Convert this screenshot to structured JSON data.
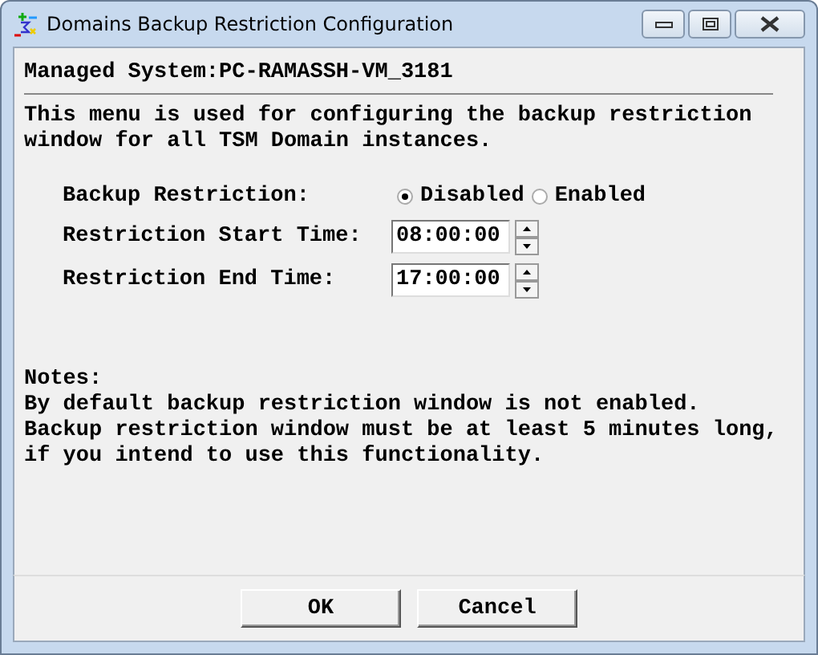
{
  "window": {
    "title": "Domains Backup Restriction Configuration"
  },
  "managed_system": "Managed System:PC-RAMASSH-VM_3181",
  "description": "This menu is used for configuring the backup restriction window for all TSM Domain instances.",
  "backup_restriction": {
    "label": "Backup Restriction:",
    "options": [
      {
        "label": "Disabled",
        "selected": true
      },
      {
        "label": "Enabled",
        "selected": false
      }
    ]
  },
  "times": [
    {
      "label": "Restriction Start Time:",
      "value": "08:00:00"
    },
    {
      "label": "Restriction End Time:",
      "value": "17:00:00"
    }
  ],
  "notes": {
    "heading": "Notes:",
    "lines": [
      "By default backup restriction window is not enabled.",
      "Backup restriction window must be at least 5 minutes long,",
      "if you intend to use this functionality."
    ]
  },
  "buttons": [
    "OK",
    "Cancel"
  ]
}
